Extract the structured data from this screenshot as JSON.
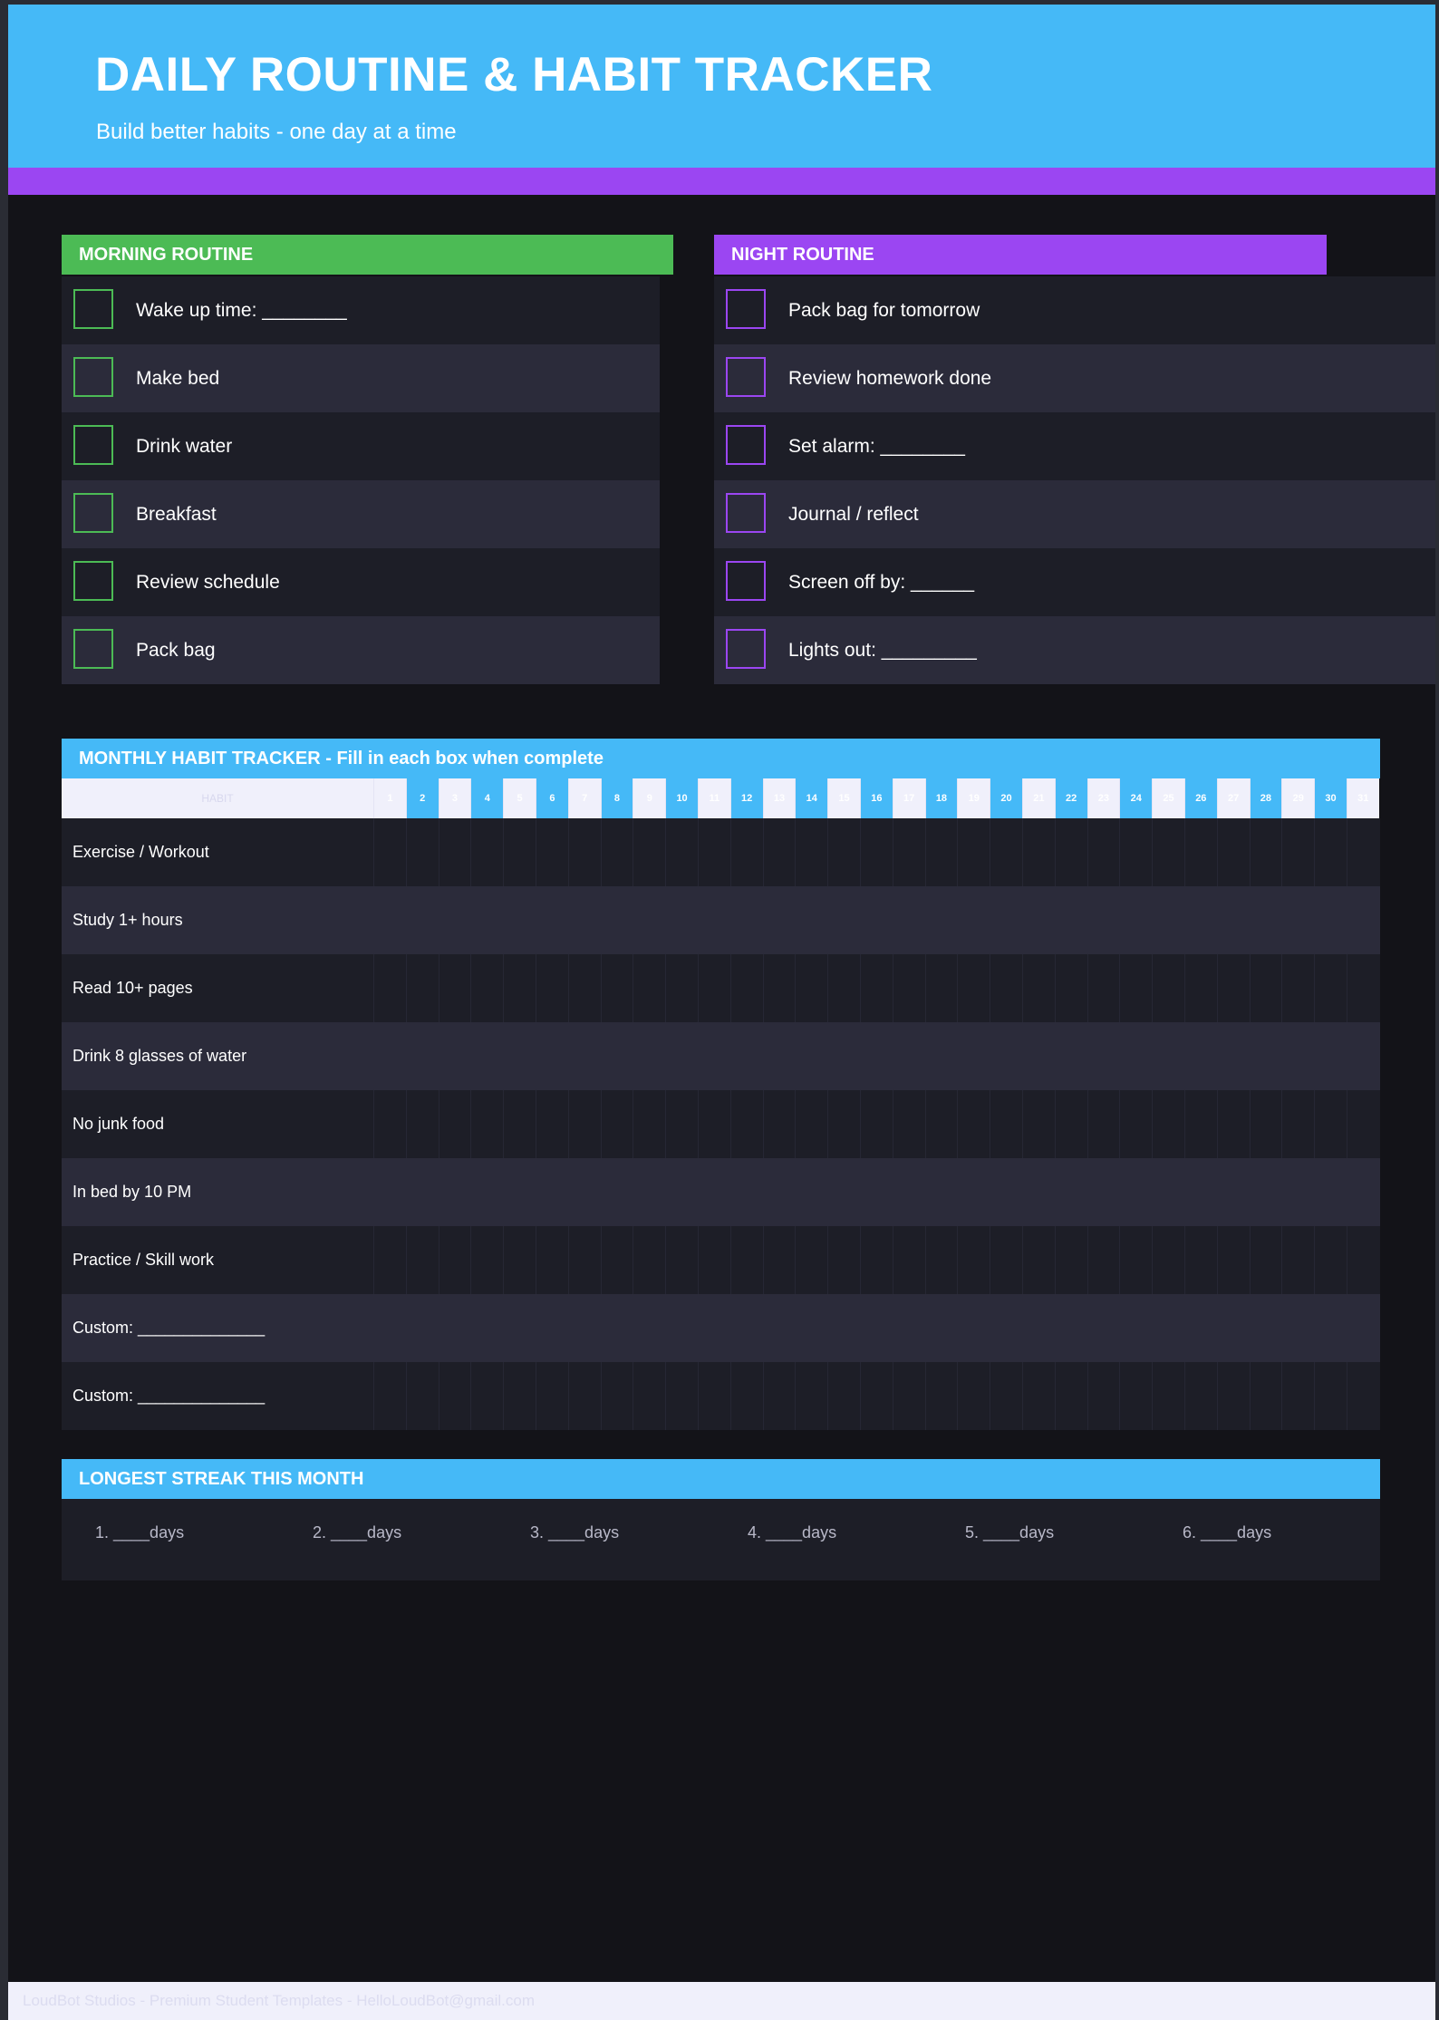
{
  "header": {
    "title": "DAILY ROUTINE & HABIT TRACKER",
    "subtitle": "Build better habits - one day at a time"
  },
  "morning": {
    "title": "MORNING ROUTINE",
    "items": [
      "Wake up time: ________",
      "Make bed",
      "Drink water",
      "Breakfast",
      "Review schedule",
      "Pack bag"
    ]
  },
  "night": {
    "title": "NIGHT ROUTINE",
    "items": [
      "Pack bag for tomorrow",
      "Review homework done",
      "Set alarm: ________",
      "Journal / reflect",
      "Screen off by: ______",
      "Lights out: _________"
    ]
  },
  "tracker": {
    "title": "MONTHLY HABIT TRACKER - Fill in each box when complete",
    "habit_header": "HABIT",
    "days": [
      "1",
      "2",
      "3",
      "4",
      "5",
      "6",
      "7",
      "8",
      "9",
      "10",
      "11",
      "12",
      "13",
      "14",
      "15",
      "16",
      "17",
      "18",
      "19",
      "20",
      "21",
      "22",
      "23",
      "24",
      "25",
      "26",
      "27",
      "28",
      "29",
      "30",
      "31"
    ],
    "habits": [
      "Exercise / Workout",
      "Study 1+ hours",
      "Read 10+ pages",
      "Drink 8 glasses of water",
      "No junk food",
      "In bed by 10 PM",
      "Practice / Skill work",
      "Custom: ______________",
      "Custom: ______________"
    ]
  },
  "streak": {
    "title": "LONGEST STREAK THIS MONTH",
    "items": [
      "1. ____days",
      "2. ____days",
      "3. ____days",
      "4. ____days",
      "5. ____days",
      "6. ____days"
    ]
  },
  "footer": {
    "text": "LoudBot Studios - Premium Student Templates - HelloLoudBot@gmail.com"
  },
  "colors": {
    "header": "#45b9f7",
    "accent_purple": "#9b46f2",
    "accent_green": "#4cbb55",
    "background": "#131318"
  }
}
